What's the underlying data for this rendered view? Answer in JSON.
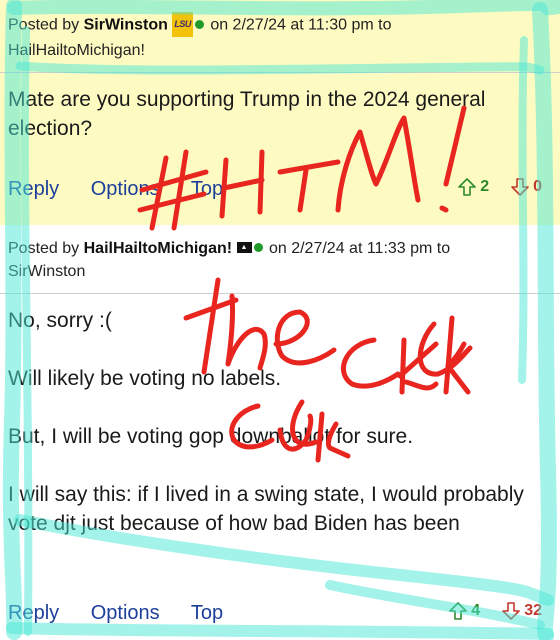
{
  "posts": [
    {
      "header_prefix": "Posted by",
      "author": "SirWinston",
      "badge": "LSU",
      "header_mid": "on 2/27/24 at 11:30 pm to",
      "recipient": "HailHailtoMichigan!",
      "paragraphs": [
        "Mate are you supporting Trump in the 2024 general election?"
      ],
      "actions": {
        "reply": "Reply",
        "options": "Options",
        "top": "Top"
      },
      "upvotes": "2",
      "downvotes": "0"
    },
    {
      "header_prefix": "Posted by",
      "author": "HailHailtoMichigan!",
      "header_mid": "on 2/27/24 at 11:33 pm to",
      "recipient": "SirWinston",
      "paragraphs": [
        "No, sorry :(",
        "Will likely be voting no labels.",
        "But, I will be voting gop downballot for sure.",
        "I will say this: if I lived in a swing state, I would probably vote djt just because of how bad Biden has been"
      ],
      "actions": {
        "reply": "Reply",
        "options": "Options",
        "top": "Top"
      },
      "upvotes": "4",
      "downvotes": "32"
    }
  ],
  "colors": {
    "post1_bg": "#fefbc2",
    "highlighter": "#49e8d6",
    "ink": "#e8261f",
    "link": "#1c3f9a",
    "upvote": "#2e8a2e",
    "downvote": "#c0392b"
  },
  "annotations": [
    "#HTM!",
    "the",
    "cuck"
  ]
}
